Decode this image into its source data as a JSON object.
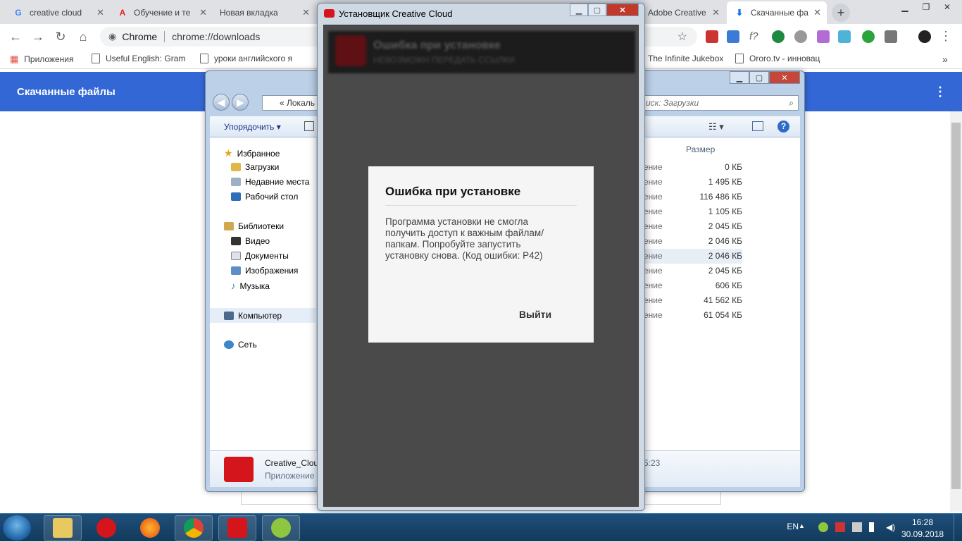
{
  "chrome": {
    "tabs": [
      {
        "label": "creative cloud",
        "icon": "google-icon"
      },
      {
        "label": "Обучение и те",
        "icon": "adobe-icon"
      },
      {
        "label": "Новая вкладка",
        "icon": ""
      },
      {
        "label": "Adobe Creative",
        "icon": ""
      },
      {
        "label": "Скачанные фа",
        "icon": "download-icon"
      }
    ],
    "new_tab_label": "+",
    "omnibox": {
      "site": "Chrome",
      "url": "chrome://downloads"
    },
    "bookmarks": [
      "Приложения",
      "Useful English: Gram",
      "уроки английского я",
      "The Infinite Jukebox",
      "Ororo.tv - инновац"
    ],
    "bookmarks_more": "»"
  },
  "downloads_page": {
    "title": "Скачанные файлы",
    "menu_icon": "⋮"
  },
  "explorer": {
    "address": "«  Локаль",
    "search_placeholder": "иск: Загрузки",
    "organize_label": "Упорядочить",
    "nav": {
      "favorites": "Избранное",
      "downloads": "Загрузки",
      "recent": "Недавние места",
      "desktop": "Рабочий стол",
      "libraries": "Библиотеки",
      "video": "Видео",
      "documents": "Документы",
      "images": "Изображения",
      "music": "Музыка",
      "computer": "Компьютер",
      "network": "Сеть"
    },
    "size_header": "Размер",
    "rows": [
      {
        "type": "ение",
        "size": "0 КБ"
      },
      {
        "type": "ение",
        "size": "1 495 КБ"
      },
      {
        "type": "ение",
        "size": "116 486 КБ"
      },
      {
        "type": "ение",
        "size": "1 105 КБ"
      },
      {
        "type": "ение",
        "size": "2 045 КБ"
      },
      {
        "type": "ение",
        "size": "2 046 КБ"
      },
      {
        "type": "ение",
        "size": "2 046 КБ"
      },
      {
        "type": "ение",
        "size": "2 045 КБ"
      },
      {
        "type": "ение",
        "size": "606 КБ"
      },
      {
        "type": "ение",
        "size": "41 562 КБ"
      },
      {
        "type": "ение",
        "size": "61 054 КБ"
      }
    ],
    "details": {
      "name": "Creative_Clou",
      "type": "Приложение",
      "time": "5:23"
    }
  },
  "installer": {
    "title": "Установщик Creative Cloud",
    "header_title": "Ошибка при установке",
    "header_sub": "НЕВОЗМОЖН ПЕРЕДАТЬ ССЫЛКИ"
  },
  "error_dialog": {
    "title": "Ошибка при установке",
    "message": "Программа установки не смогла получить доступ к важным файлам/папкам. Попробуйте запустить установку снова. (Код ошибки: P42)",
    "quit_label": "Выйти"
  },
  "taskbar": {
    "lang": "EN",
    "time": "16:28",
    "date": "30.09.2018"
  },
  "colors": {
    "chrome_blue": "#3367d6",
    "adobe_red": "#d4151c"
  }
}
